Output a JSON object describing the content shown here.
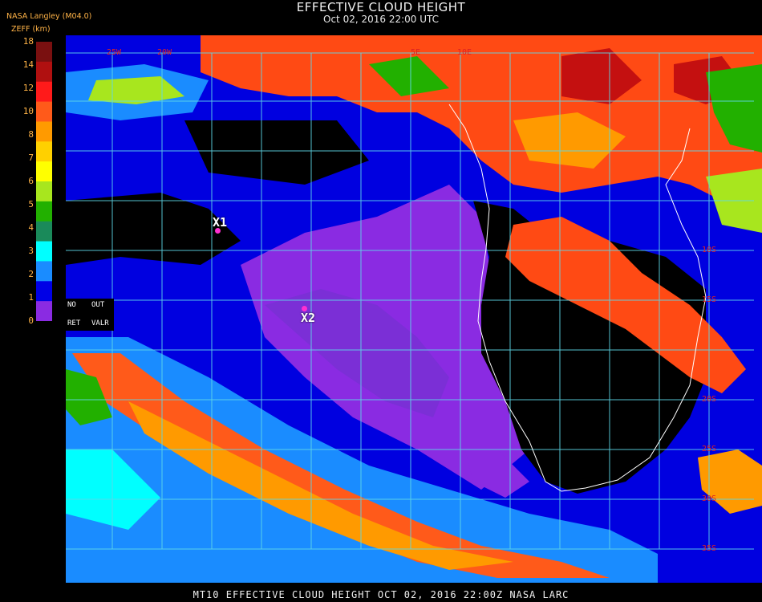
{
  "header": {
    "title": "EFFECTIVE CLOUD HEIGHT",
    "subtitle": "Oct 02, 2016 22:00 UTC",
    "producer": "NASA Langley (M04.0)",
    "units": "ZEFF (km)"
  },
  "scale": {
    "ticks": [
      "18",
      "14",
      "12",
      "10",
      "8",
      "7",
      "6",
      "5",
      "4",
      "3",
      "2",
      "1",
      "0"
    ],
    "colors": [
      "#7a1010",
      "#b01010",
      "#ff1a1a",
      "#ff5a1a",
      "#ff9a00",
      "#ffd000",
      "#ffff00",
      "#a8e61e",
      "#22b000",
      "#1a8a5a",
      "#00ffff",
      "#1a8cff",
      "#0000e6",
      "#8a2be2"
    ]
  },
  "legend_labels": {
    "no": "NO",
    "out": "OUT",
    "ret": "RET",
    "valr": "VALR"
  },
  "grid_labels": [
    "25W",
    "20W",
    "5E",
    "10E",
    "10S",
    "15S",
    "20S",
    "25S",
    "30S",
    "35S"
  ],
  "markers": [
    {
      "label": "X1"
    },
    {
      "label": "X2"
    }
  ],
  "footer": "MT10  EFFECTIVE CLOUD HEIGHT  OCT 02, 2016 22:00Z  NASA LARC"
}
